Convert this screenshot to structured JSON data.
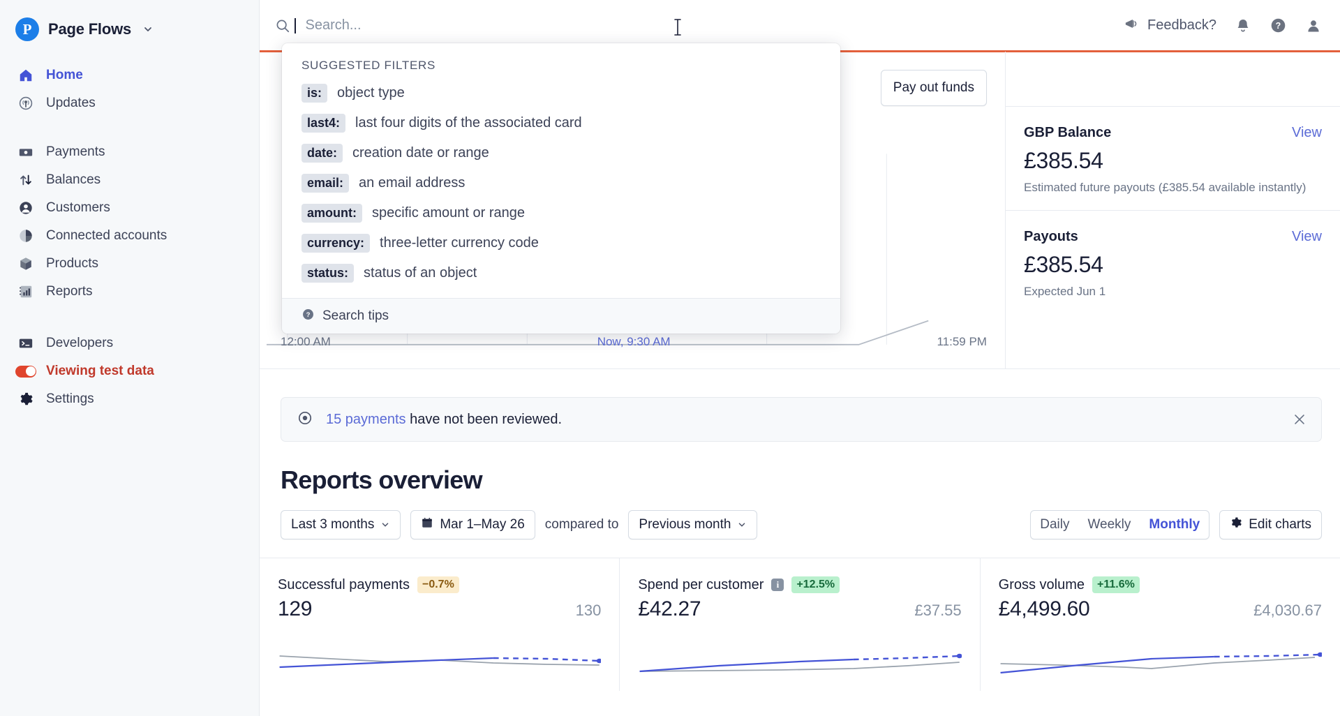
{
  "brand": {
    "logo_letter": "P",
    "name": "Page Flows",
    "caret": "chevron-down"
  },
  "sidebar": {
    "groups": [
      {
        "items": [
          {
            "label": "Home",
            "icon": "home-icon",
            "active": true
          },
          {
            "label": "Updates",
            "icon": "broadcast-icon",
            "active": false
          }
        ]
      },
      {
        "items": [
          {
            "label": "Payments",
            "icon": "payments-icon",
            "active": false
          },
          {
            "label": "Balances",
            "icon": "balances-icon",
            "active": false
          },
          {
            "label": "Customers",
            "icon": "customers-icon",
            "active": false
          },
          {
            "label": "Connected accounts",
            "icon": "connected-accounts-icon",
            "active": false
          },
          {
            "label": "Products",
            "icon": "products-icon",
            "active": false
          },
          {
            "label": "Reports",
            "icon": "reports-icon",
            "active": false
          }
        ]
      },
      {
        "items": [
          {
            "label": "Developers",
            "icon": "terminal-icon",
            "active": false
          },
          {
            "label": "Viewing test data",
            "icon": "toggle-on-icon",
            "active": false
          },
          {
            "label": "Settings",
            "icon": "gear-icon",
            "active": false
          }
        ]
      }
    ]
  },
  "topbar": {
    "search": {
      "placeholder": "Search...",
      "value": "",
      "icon": "search-icon"
    },
    "feedback_label": "Feedback?",
    "feedback_icon": "megaphone-icon",
    "notifications_icon": "bell-icon",
    "help_icon": "question-circle-icon",
    "account_icon": "user-avatar-icon"
  },
  "search_dropdown": {
    "section_title": "SUGGESTED FILTERS",
    "filters": [
      {
        "token": "is:",
        "description": "object type"
      },
      {
        "token": "last4:",
        "description": "last four digits of the associated card"
      },
      {
        "token": "date:",
        "description": "creation date or range"
      },
      {
        "token": "email:",
        "description": "an email address"
      },
      {
        "token": "amount:",
        "description": "specific amount or range"
      },
      {
        "token": "currency:",
        "description": "three-letter currency code"
      },
      {
        "token": "status:",
        "description": "status of an object"
      }
    ],
    "footer_label": "Search tips",
    "footer_icon": "question-circle-icon"
  },
  "overview": {
    "pay_out_button": "Pay out funds",
    "balances": [
      {
        "title": "GBP Balance",
        "view_label": "View",
        "amount": "£385.54",
        "subtitle": "Estimated future payouts (£385.54 available instantly)"
      },
      {
        "title": "Payouts",
        "view_label": "View",
        "amount": "£385.54",
        "subtitle": "Expected Jun 1"
      }
    ],
    "chart_axis": {
      "start": "12:00 AM",
      "now": "Now, 9:30 AM",
      "end": "11:59 PM"
    }
  },
  "alert": {
    "icon": "eye-icon",
    "link_text": "15 payments",
    "rest_text": " have not been reviewed.",
    "close_icon": "close-icon"
  },
  "reports": {
    "title": "Reports overview",
    "range_select": "Last 3 months",
    "date_range": "Mar 1–May 26",
    "date_icon": "calendar-icon",
    "compared_label": "compared to",
    "compare_select": "Previous month",
    "granularity": [
      {
        "label": "Daily",
        "selected": false
      },
      {
        "label": "Weekly",
        "selected": false
      },
      {
        "label": "Monthly",
        "selected": true
      }
    ],
    "edit_charts_label": "Edit charts",
    "edit_charts_icon": "gear-icon"
  },
  "chart_data": [
    {
      "type": "line",
      "title": "Successful payments",
      "badge": "−0.7%",
      "badge_sign": "neg",
      "current_value": "129",
      "previous_value": "130",
      "series": [
        {
          "name": "current",
          "values": [
            20,
            26,
            34,
            40,
            44,
            46,
            47,
            48
          ],
          "color": "#4453d6",
          "dashed_from": 4
        },
        {
          "name": "previous",
          "values": [
            46,
            40,
            36,
            30,
            34,
            38,
            42,
            45
          ],
          "color": "#9aa3ad"
        }
      ],
      "ylim": [
        0,
        60
      ]
    },
    {
      "type": "line",
      "title": "Spend per customer",
      "badge": "+12.5%",
      "badge_sign": "pos",
      "current_value": "£42.27",
      "previous_value": "£37.55",
      "info_icon": "info-icon",
      "series": [
        {
          "name": "current",
          "values": [
            8,
            18,
            28,
            36,
            41,
            45,
            48,
            52
          ],
          "color": "#4453d6",
          "dashed_from": 4
        },
        {
          "name": "previous",
          "values": [
            7,
            9,
            11,
            12,
            14,
            22,
            34,
            44
          ],
          "color": "#9aa3ad"
        }
      ],
      "ylim": [
        0,
        60
      ]
    },
    {
      "type": "line",
      "title": "Gross volume",
      "badge": "+11.6%",
      "badge_sign": "pos",
      "current_value": "£4,499.60",
      "previous_value": "£4,030.67",
      "series": [
        {
          "name": "current",
          "values": [
            6,
            20,
            34,
            44,
            48,
            50,
            52,
            54
          ],
          "color": "#4453d6",
          "dashed_from": 4
        },
        {
          "name": "previous",
          "values": [
            32,
            30,
            25,
            22,
            18,
            30,
            42,
            50
          ],
          "color": "#9aa3ad"
        }
      ],
      "ylim": [
        0,
        60
      ]
    }
  ],
  "colors": {
    "accent": "#4453d6",
    "link": "#5b6bd6",
    "testmode": "#c0392b",
    "testbar": "#e3603c",
    "positive_badge_bg": "#b9f0cd",
    "negative_badge_bg": "#fbeccc"
  }
}
